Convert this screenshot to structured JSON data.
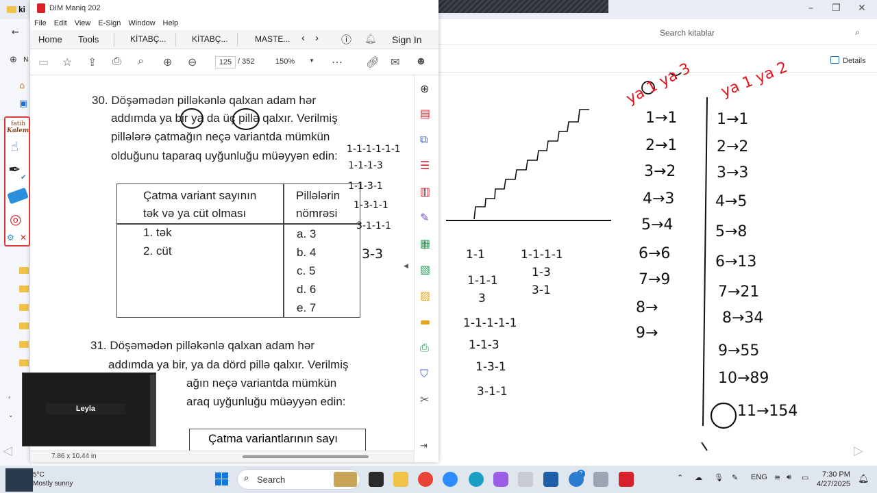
{
  "explorer": {
    "tab_label": "ki",
    "search_placeholder": "Search kitablar",
    "details_label": "Details",
    "nav_new": "N"
  },
  "pdf": {
    "window_title": "DIM Maniq 202",
    "menu": [
      "File",
      "Edit",
      "View",
      "E-Sign",
      "Window",
      "Help"
    ],
    "tabs": [
      "Home",
      "Tools",
      "KİTABÇ...",
      "KİTABÇ...",
      "MASTE..."
    ],
    "sign_in": "Sign In",
    "page_current": "125",
    "page_total": "/ 352",
    "zoom": "150%",
    "page_size": "7.86 x 10.44 in"
  },
  "kalem": {
    "brand_line1": "fatih",
    "brand_line2": "Kalem"
  },
  "document": {
    "q30_lines": [
      "30. Döşəmədən pilləkənlə qalxan adam hər",
      "addımda ya bir ya da üç pillə qalxır. Verilmiş",
      "pillələrə çatmağın neçə variantda mümkün",
      "olduğunu taparaq uyğunluğu müəyyən edin:"
    ],
    "table_header_left": [
      "Çatma variant sayının",
      "tək və ya cüt olması"
    ],
    "table_header_right": [
      "Pillələrin",
      "nömrəsi"
    ],
    "table_left": [
      "1. tək",
      "2. cüt"
    ],
    "table_right": [
      "a. 3",
      "b. 4",
      "c. 5",
      "d. 6",
      "e. 7"
    ],
    "q31_lines": [
      "31.  Döşəmədən pilləkənlə qalxan adam hər",
      "addımda ya bir, ya da dörd pillə qalxır. Verilmiş",
      "ağın neçə variantda mümkün",
      "araq uyğunluğu müəyyən edin:"
    ],
    "table2_header": "Çatma variantlarının sayı"
  },
  "margin_notes": [
    "1-1-1-1-1-1",
    "1-1-1-3",
    "1-1-3-1",
    "1-3-1-1",
    "3-1-1-1",
    "3-3"
  ],
  "whiteboard": {
    "combos_a": [
      "1-1",
      "1-1-1",
      "3"
    ],
    "combos_b": [
      "1-1-1-1",
      "1-3",
      "3-1"
    ],
    "combos_c": [
      "1-1-1-1-1",
      "1-1-3",
      "1-3-1",
      "3-1-1"
    ],
    "header_left": "ya 1 ya 3",
    "header_right": "ya 1 ya 2",
    "left_sequence": [
      "1→1",
      "2→1",
      "3→2",
      "4→3",
      "5→4",
      "6→6",
      "7→9",
      "8→",
      "9→"
    ],
    "right_sequence": [
      "1→1",
      "2→2",
      "3→3",
      "4→5",
      "5→8",
      "6→13",
      "7→21",
      "8→34",
      "9→55",
      "10→89",
      "11→154"
    ]
  },
  "video": {
    "participant_name": "Leyla"
  },
  "taskbar": {
    "weather_temp": "5°C",
    "weather_desc": "Mostly sunny",
    "search_label": "Search",
    "language": "ENG",
    "time": "7:30 PM",
    "date": "4/27/2025",
    "badge_count": "2"
  }
}
